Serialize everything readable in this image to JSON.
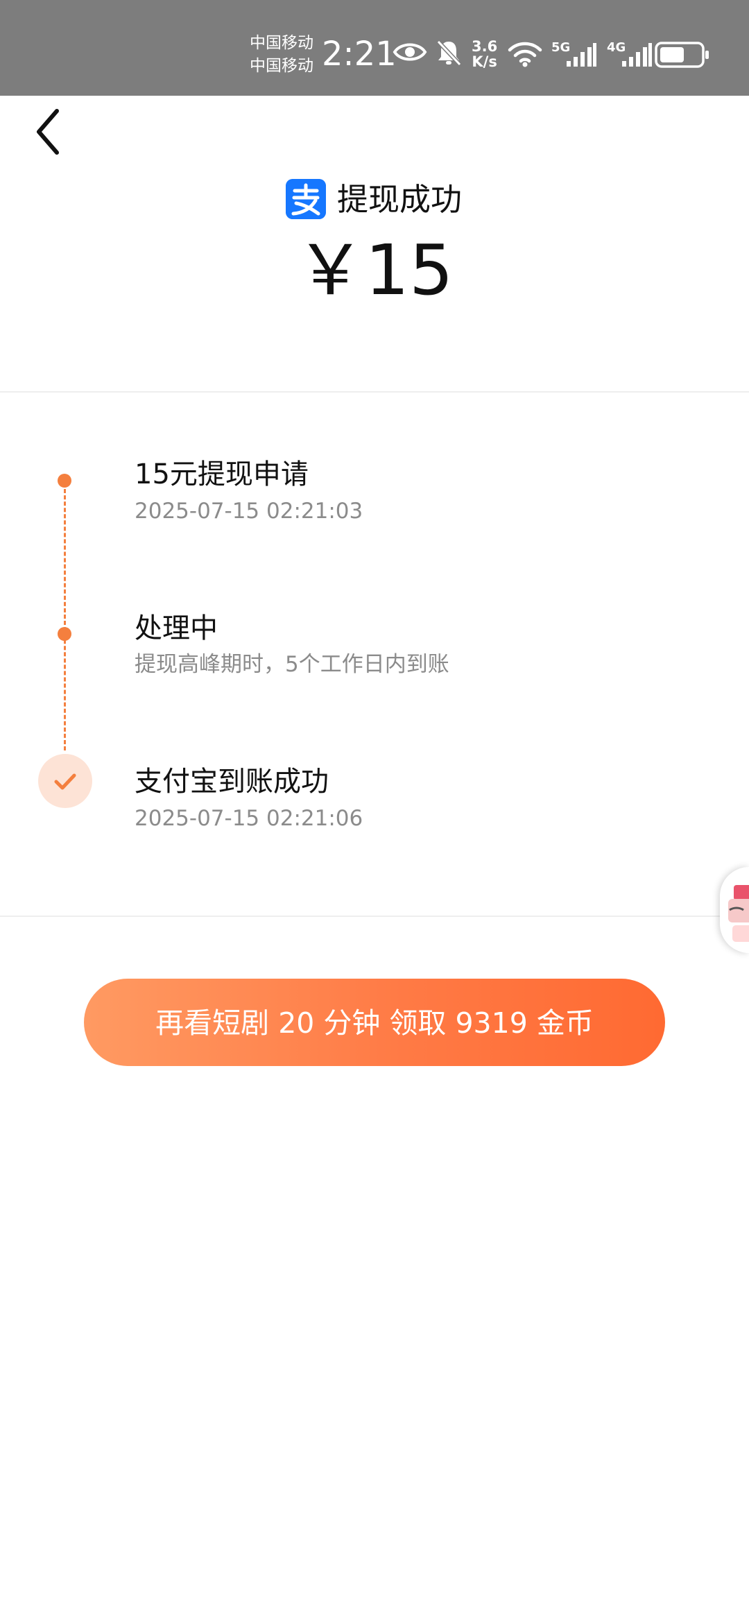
{
  "status_bar": {
    "carrier_1": "中国移动",
    "carrier_2": "中国移动",
    "time": "2:21",
    "net_speed_value": "3.6",
    "net_speed_unit": "K/s",
    "signal_1_label": "5G",
    "signal_2_label": "4G",
    "icons": [
      "eye-icon",
      "bell-muted-icon",
      "wifi-icon",
      "signal-icon",
      "battery-icon"
    ]
  },
  "header": {
    "brand_icon": "alipay-icon",
    "title": "提现成功",
    "amount": "￥15"
  },
  "timeline": {
    "steps": [
      {
        "title": "15元提现申请",
        "subtitle": "2025-07-15 02:21:03"
      },
      {
        "title": "处理中",
        "subtitle": "提现高峰期时，5个工作日内到账"
      },
      {
        "title": "支付宝到账成功",
        "subtitle": "2025-07-15 02:21:06"
      }
    ]
  },
  "cta": {
    "label": "再看短剧 20 分钟 领取 9319 金币"
  },
  "colors": {
    "status_bar_bg": "#7d7d7d",
    "accent_orange": "#f47f3e",
    "alipay_blue": "#1677ff",
    "cta_gradient_start": "#ff9a62",
    "cta_gradient_end": "#ff6a32"
  }
}
